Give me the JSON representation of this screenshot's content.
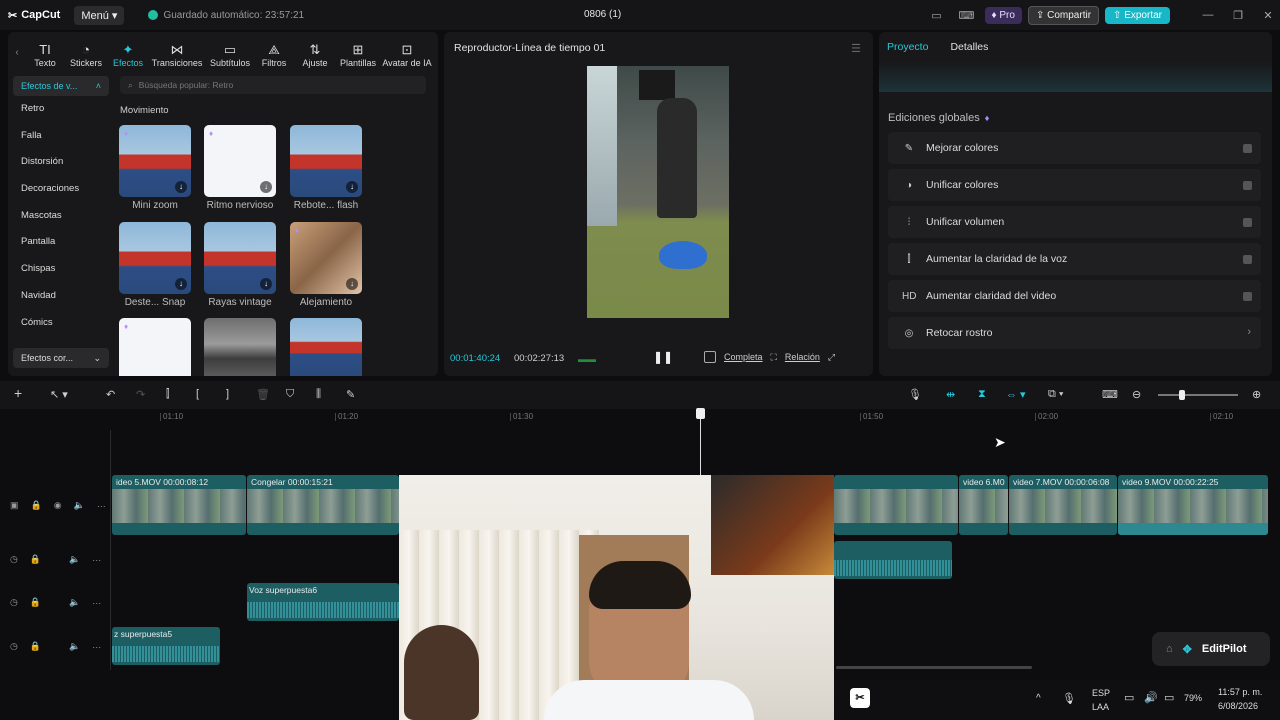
{
  "titlebar": {
    "app_name": "CapCut",
    "menu_label": "Menú",
    "autosave": "Guardado automático: 23:57:21",
    "project_title": "0806 (1)",
    "pro_label": "Pro",
    "share_label": "Compartir",
    "export_label": "Exportar",
    "accent": "#17b7c8"
  },
  "categories": [
    {
      "icon": "TI",
      "label": "Texto"
    },
    {
      "icon": "◔",
      "label": "Stickers"
    },
    {
      "icon": "✦",
      "label": "Efectos"
    },
    {
      "icon": "⋈",
      "label": "Transiciones"
    },
    {
      "icon": "▭",
      "label": "Subtítulos"
    },
    {
      "icon": "⟁",
      "label": "Filtros"
    },
    {
      "icon": "⇅",
      "label": "Ajuste"
    },
    {
      "icon": "⊞",
      "label": "Plantillas"
    },
    {
      "icon": "⊡",
      "label": "Avatar de IA"
    }
  ],
  "sidebar": {
    "head": "Efectos de v...",
    "items": [
      "Retro",
      "Falla",
      "Distorsión",
      "Decoraciones",
      "Mascotas",
      "Pantalla",
      "Chispas",
      "Navidad",
      "Cómics"
    ],
    "footer": "Efectos cor..."
  },
  "search_placeholder": "Búsqueda popular: Retro",
  "section_title": "Movimiento",
  "effects": [
    "Mini zoom",
    "Ritmo nervioso",
    "Rebote... flash",
    "Deste... Snap",
    "Rayas vintage",
    "Alejamiento"
  ],
  "player": {
    "title": "Reproductor-Línea de tiempo 01",
    "time_current": "00:01:40:24",
    "time_total": "00:02:27:13",
    "complete_label": "Completa",
    "ratio_label": "Relación"
  },
  "right_panel": {
    "tab_project": "Proyecto",
    "tab_details": "Detalles",
    "heading": "Ediciones globales",
    "rows": [
      {
        "icon": "✎",
        "label": "Mejorar colores"
      },
      {
        "icon": "◑",
        "label": "Unificar colores"
      },
      {
        "icon": "⫶",
        "label": "Unificar volumen"
      },
      {
        "icon": "⫿",
        "label": "Aumentar la claridad de la voz"
      },
      {
        "icon": "HD",
        "label": "Aumentar claridad del video"
      },
      {
        "icon": "◎",
        "label": "Retocar rostro"
      }
    ]
  },
  "ruler_labels": [
    "01:10",
    "01:20",
    "01:30",
    "01:50",
    "02:00",
    "02:10"
  ],
  "clips": {
    "c1": "ideo 5.MOV   00:00:08:12",
    "c2": "Congelar   00:00:15:21",
    "c3": "video 6.M0",
    "c4": "video 7.MOV   00:00:06:08",
    "c5": "video 9.MOV   00:00:22:25",
    "voice6": "Voz superpuesta6",
    "voice5": "z superpuesta5"
  },
  "editpilot_label": "EditPilot",
  "tray": {
    "lang1": "ESP",
    "lang2": "LAA",
    "battery": "79%",
    "time": "11:57 p. m.",
    "date": "6/08/2026"
  }
}
